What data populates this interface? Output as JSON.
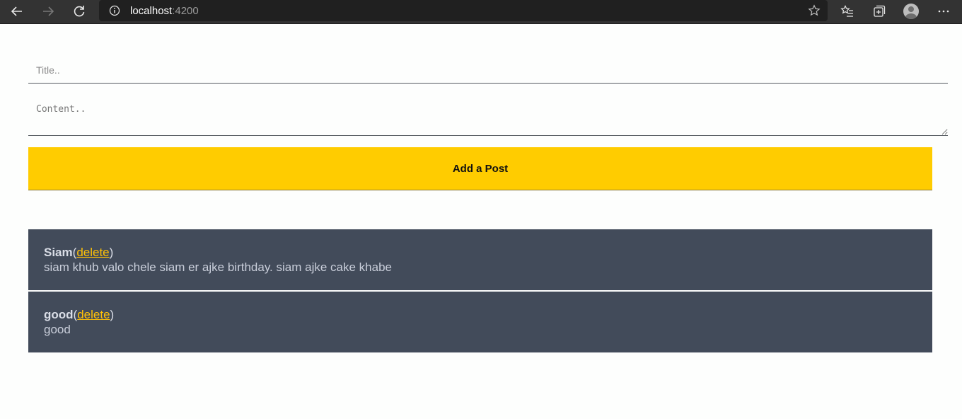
{
  "browser": {
    "url_host": "localhost",
    "url_port": ":4200"
  },
  "form": {
    "title_placeholder": "Title..",
    "content_placeholder": "Content..",
    "submit_label": "Add a Post"
  },
  "posts": [
    {
      "title": "Siam",
      "open": "(",
      "delete_label": "delete",
      "close": ")",
      "content": "siam khub valo chele siam er ajke birthday. siam ajke cake khabe"
    },
    {
      "title": "good",
      "open": "(",
      "delete_label": "delete",
      "close": ")",
      "content": "good"
    }
  ],
  "colors": {
    "accent": "#ffcc00",
    "post_bg": "#424b5a",
    "link": "#ffc107"
  }
}
